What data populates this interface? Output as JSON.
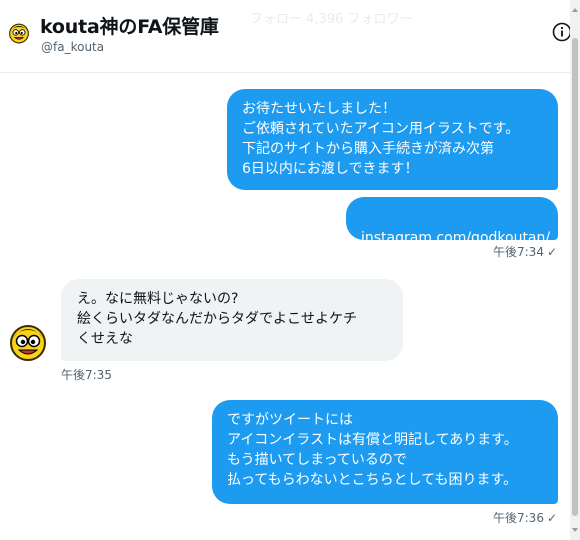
{
  "header": {
    "title": "kouta神のFA保管庫",
    "handle": "@fa_kouta",
    "ghost_text": "フォロー  4,396 フォロワー"
  },
  "messages": [
    {
      "direction": "outgoing",
      "text": "お待たせいたしました！\nご依頼されていたアイコン用イラストです。\n下記のサイトから購入手続きが済み次第\n6日以内にお渡しできます！"
    },
    {
      "direction": "outgoing",
      "link_text": "instagram.com/godkoutan/",
      "timestamp": "午後7:34",
      "status": "✓"
    },
    {
      "direction": "incoming",
      "text": "え。なに無料じゃないの?\n絵くらいタダなんだからタダでよこせよケチ\nくせえな",
      "timestamp": "午後7:35"
    },
    {
      "direction": "outgoing",
      "text": "ですがツイートには\nアイコンイラストは有償と明記してあります。\nもう描いてしまっているので\n払ってもらわないとこちらとしても困ります。",
      "timestamp": "午後7:36",
      "status": "✓"
    }
  ],
  "colors": {
    "outgoing_bubble": "#1d9bf0",
    "incoming_bubble": "#eff3f4",
    "muted_text": "#536471"
  },
  "icons": {
    "info": "info-icon",
    "avatar": "avatar-yellow-face"
  }
}
